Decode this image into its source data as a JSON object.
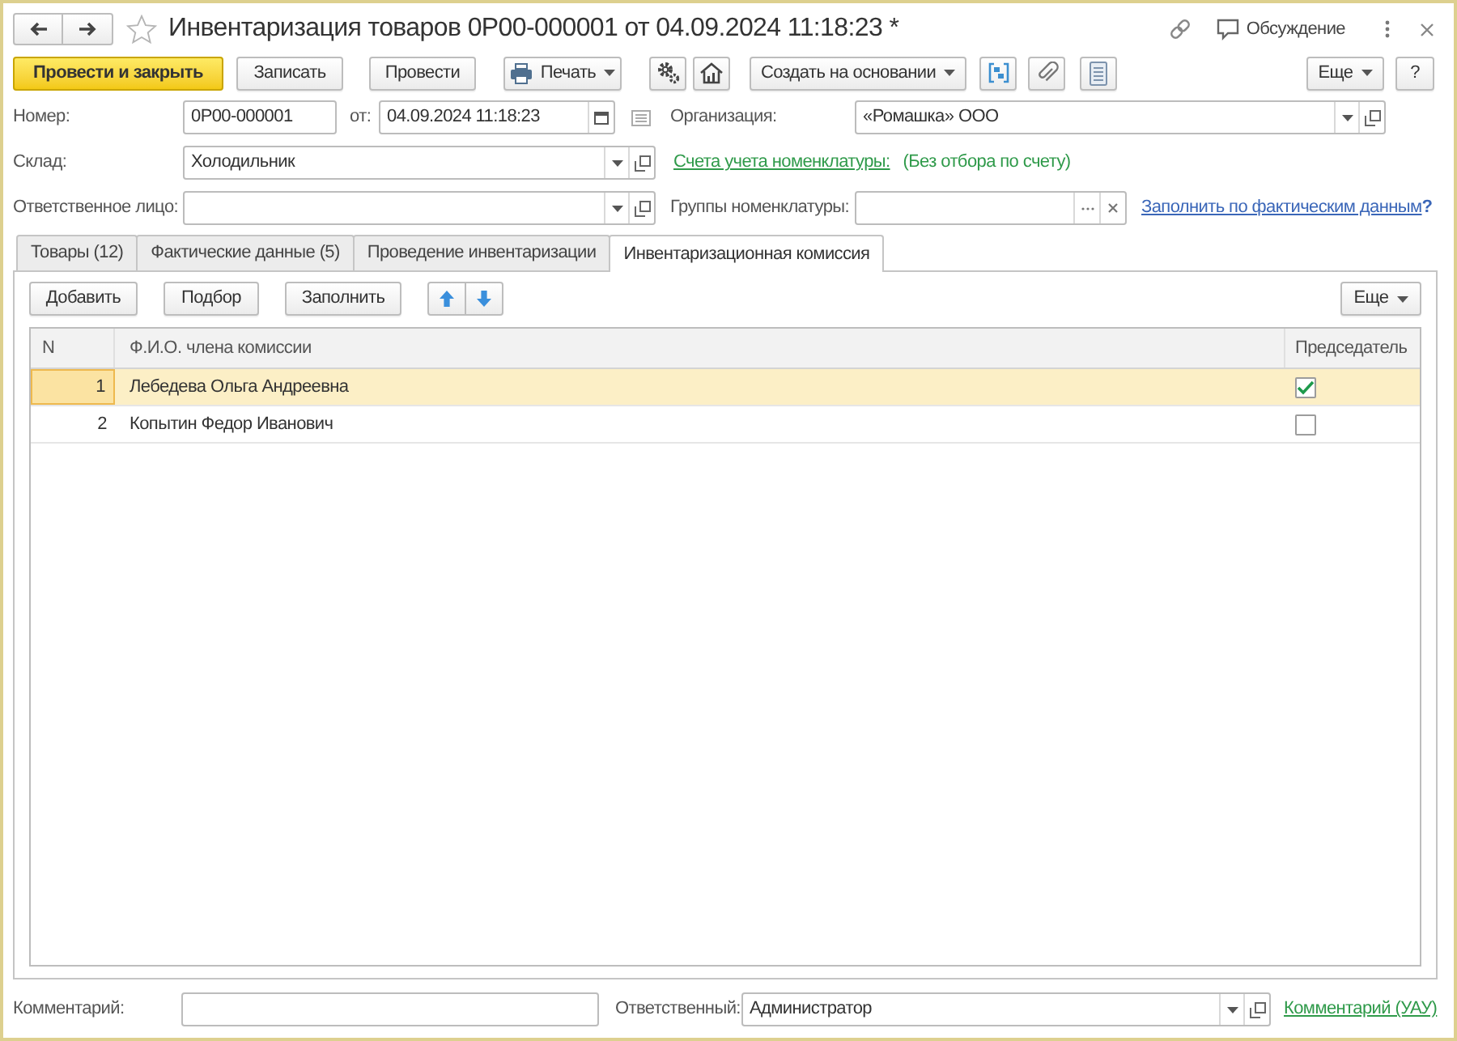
{
  "window": {
    "title": "Инвентаризация товаров 0Р00-000001 от 04.09.2024 11:18:23 *",
    "discussion": "Обсуждение"
  },
  "toolbar": {
    "post_and_close": "Провести и закрыть",
    "buttons": [
      "Записать",
      "Провести"
    ],
    "print": "Печать",
    "create_based_on": "Создать на основании",
    "more": "Еще",
    "help": "?"
  },
  "header": {
    "number": {
      "label": "Номер:",
      "value": "0Р00-000001"
    },
    "date": {
      "label": "от:",
      "value": "04.09.2024 11:18:23"
    },
    "organization": {
      "label": "Организация:",
      "value": "«Ромашка» ООО"
    },
    "warehouse": {
      "label": "Склад:",
      "value": "Холодильник"
    },
    "accounts": {
      "link": "Счета учета номенклатуры:",
      "value": "(Без отбора по счету)"
    },
    "responsible_person": {
      "label": "Ответственное лицо:"
    },
    "item_groups": {
      "label": "Группы номенклатуры:"
    },
    "fill_link": "Заполнить по фактическим данным",
    "help": "?"
  },
  "tabs": [
    {
      "label": "Товары (12)",
      "selected": false
    },
    {
      "label": "Фактические данные (5)",
      "selected": false
    },
    {
      "label": "Проведение инвентаризации",
      "selected": false
    },
    {
      "label": "Инвентаризационная комиссия",
      "selected": true
    }
  ],
  "table_toolbar": {
    "buttons": [
      "Добавить",
      "Подбор",
      "Заполнить"
    ],
    "more": "Еще"
  },
  "table": {
    "columns": [
      "N",
      "Ф.И.О. члена комиссии",
      "Председатель"
    ],
    "rows": [
      {
        "n": "1",
        "name": "Лебедева Ольга Андреевна",
        "chairman": true,
        "selected": true
      },
      {
        "n": "2",
        "name": "Копытин Федор Иванович",
        "chairman": false,
        "selected": false
      }
    ]
  },
  "footer": {
    "comment": {
      "label": "Комментарий:"
    },
    "responsible": {
      "label": "Ответственный:",
      "value": "Администратор"
    },
    "comment_link": "Комментарий (УАУ)"
  }
}
